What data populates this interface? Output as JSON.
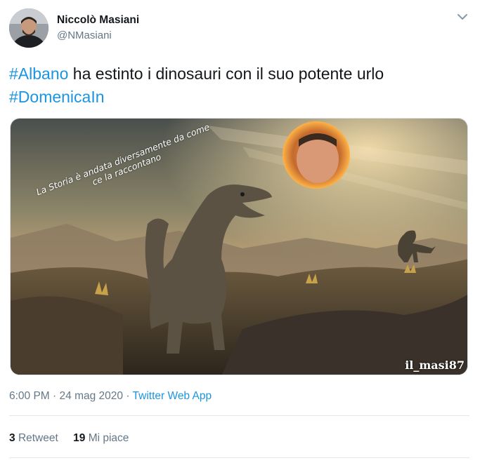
{
  "author": {
    "name": "Niccolò Masiani",
    "handle": "@NMasiani"
  },
  "tweet": {
    "hashtag_1": "#Albano",
    "text": " ha estinto i dinosauri con il suo potente urlo",
    "hashtag_2": "#DomenicaIn"
  },
  "media": {
    "caption_line_1": "La Storia è andata diversamente da come",
    "caption_line_2": "ce la raccontano",
    "watermark": "il_masi87"
  },
  "meta": {
    "time": "6:00 PM",
    "separator_1": " · ",
    "date": "24 mag 2020",
    "separator_2": " · ",
    "source": "Twitter Web App"
  },
  "stats": {
    "retweet_count": "3",
    "retweet_label": "Retweet",
    "like_count": "19",
    "like_label": "Mi piace"
  },
  "colors": {
    "link": "#1b95e0",
    "secondary_text": "#657786",
    "divider": "#e1e8ed"
  },
  "icons": [
    "chevron-down-icon"
  ]
}
